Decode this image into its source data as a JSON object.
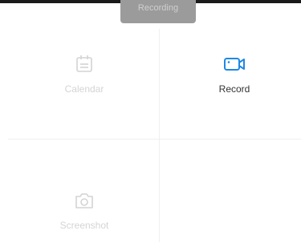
{
  "toast": {
    "text": "Recording"
  },
  "tiles": [
    {
      "label": "Calendar",
      "icon": "calendar-icon",
      "state": "disabled"
    },
    {
      "label": "Record",
      "icon": "video-camera-icon",
      "state": "active"
    },
    {
      "label": "Screenshot",
      "icon": "camera-icon",
      "state": "disabled"
    }
  ],
  "colors": {
    "accent": "#1e88e5",
    "disabled": "#d4d4d4",
    "toast_bg": "#9b9b9b"
  }
}
